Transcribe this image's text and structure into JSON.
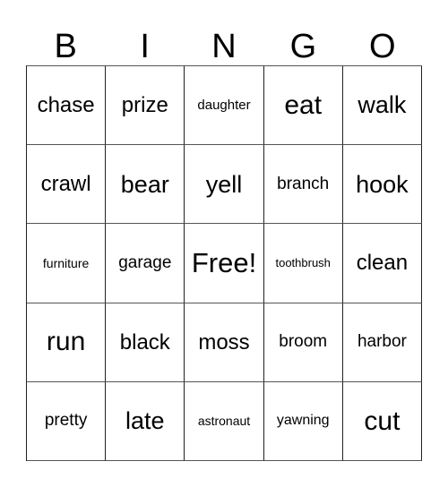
{
  "card": {
    "title": "BINGO",
    "header_letters": [
      "B",
      "I",
      "N",
      "G",
      "O"
    ],
    "free_space_label": "Free!",
    "colors": {
      "background": "#ffffff",
      "text": "#000000",
      "grid_line": "#222222",
      "grid_line_light": "#555555"
    },
    "rows": [
      [
        {
          "text": "chase",
          "size_class": "len-5"
        },
        {
          "text": "prize",
          "size_class": "len-5"
        },
        {
          "text": "daughter",
          "size_class": "len-8"
        },
        {
          "text": "eat",
          "size_class": "len-3"
        },
        {
          "text": "walk",
          "size_class": "len-4"
        }
      ],
      [
        {
          "text": "crawl",
          "size_class": "len-5"
        },
        {
          "text": "bear",
          "size_class": "len-4"
        },
        {
          "text": "yell",
          "size_class": "len-4"
        },
        {
          "text": "branch",
          "size_class": "len-6"
        },
        {
          "text": "hook",
          "size_class": "len-4"
        }
      ],
      [
        {
          "text": "furniture",
          "size_class": "len-9"
        },
        {
          "text": "garage",
          "size_class": "len-6"
        },
        {
          "text": "Free!",
          "size_class": "free-space"
        },
        {
          "text": "toothbrush",
          "size_class": "len-10"
        },
        {
          "text": "clean",
          "size_class": "len-5"
        }
      ],
      [
        {
          "text": "run",
          "size_class": "len-3"
        },
        {
          "text": "black",
          "size_class": "len-5"
        },
        {
          "text": "moss",
          "size_class": "len-5"
        },
        {
          "text": "broom",
          "size_class": "len-6"
        },
        {
          "text": "harbor",
          "size_class": "len-6"
        }
      ],
      [
        {
          "text": "pretty",
          "size_class": "len-6"
        },
        {
          "text": "late",
          "size_class": "len-4"
        },
        {
          "text": "astronaut",
          "size_class": "len-9"
        },
        {
          "text": "yawning",
          "size_class": "len-7"
        },
        {
          "text": "cut",
          "size_class": "len-3"
        }
      ]
    ]
  }
}
